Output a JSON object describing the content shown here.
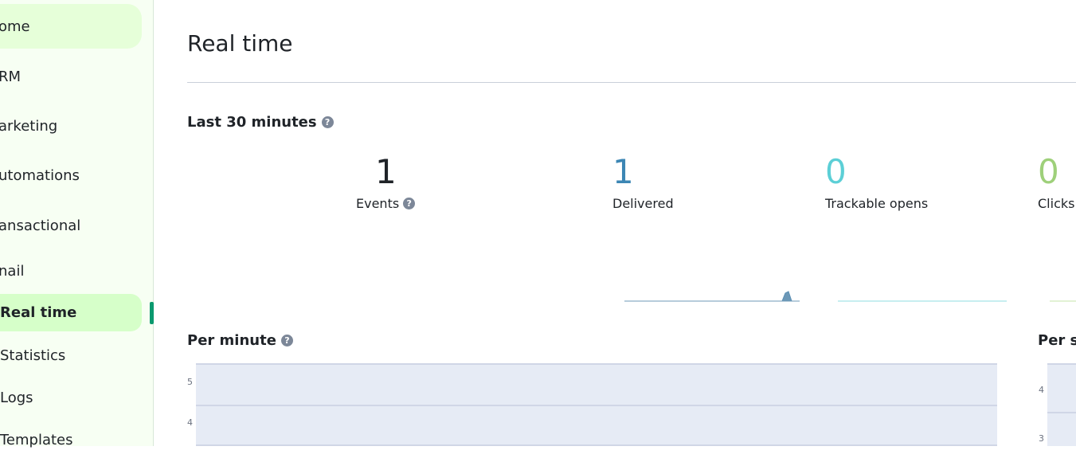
{
  "sidebar": {
    "items": [
      {
        "label": "ome"
      },
      {
        "label": "RM"
      },
      {
        "label": "arketing"
      },
      {
        "label": "utomations"
      },
      {
        "label": "ansactional"
      },
      {
        "label": "nail"
      },
      {
        "label": "Real time"
      },
      {
        "label": "Statistics"
      },
      {
        "label": "Logs"
      },
      {
        "label": "Templates"
      }
    ]
  },
  "header": {
    "title": "Real time"
  },
  "last30": {
    "title": "Last 30 minutes",
    "metrics": [
      {
        "value": "1",
        "label": "Events",
        "color": "#1f2328"
      },
      {
        "value": "1",
        "label": "Delivered",
        "color": "#3c86b4"
      },
      {
        "value": "0",
        "label": "Trackable opens",
        "color": "#5ccfd6"
      },
      {
        "value": "0",
        "label": "Clicks",
        "color": "#9ed07a"
      }
    ]
  },
  "per_minute": {
    "title": "Per minute",
    "yticks": [
      "5",
      "4"
    ]
  },
  "per_second": {
    "title": "Per s",
    "yticks": [
      "4",
      "3"
    ]
  },
  "colors": {
    "accent": "#0b996e",
    "chart_bg": "#e6ebf5"
  }
}
